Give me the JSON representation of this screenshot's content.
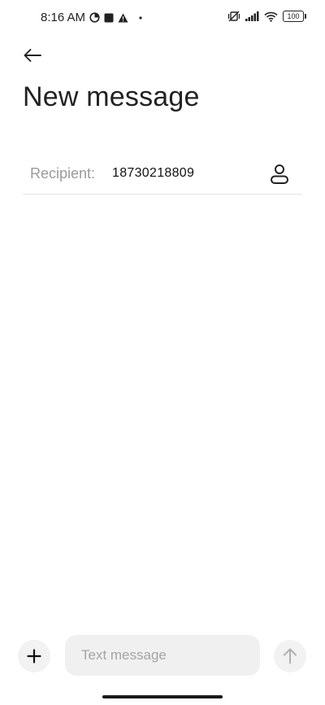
{
  "status_bar": {
    "time": "8:16 AM",
    "left_icons": [
      "data-saver-icon",
      "app-notification-icon",
      "warning-icon",
      "dot-icon"
    ],
    "right_icons": [
      "vibrate-off-icon",
      "signal-icon",
      "wifi-icon"
    ],
    "battery": "100"
  },
  "header": {
    "back_icon": "arrow-left-icon",
    "title": "New message"
  },
  "recipient": {
    "label": "Recipient:",
    "value": "18730218809",
    "contact_icon": "person-icon"
  },
  "composer": {
    "add_icon": "plus-icon",
    "placeholder": "Text message",
    "value": "",
    "send_icon": "arrow-up-icon"
  },
  "colors": {
    "background": "#ffffff",
    "text": "#222222",
    "muted": "#9a9a9a",
    "field_bg": "#f0f0f0"
  }
}
